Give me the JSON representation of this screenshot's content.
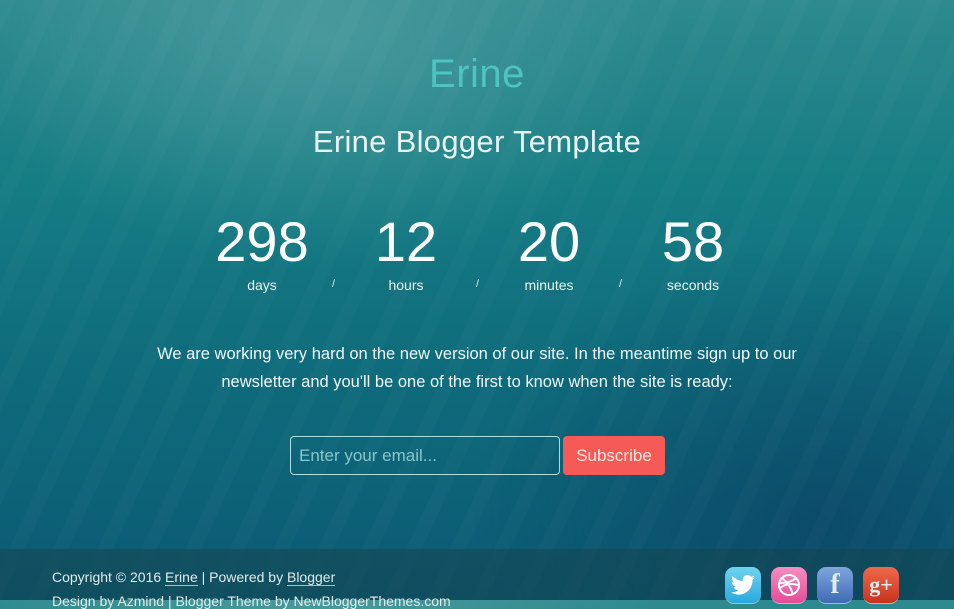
{
  "header": {
    "title": "Erine",
    "subtitle": "Erine Blogger Template"
  },
  "countdown": {
    "units": [
      {
        "value": "298",
        "label": "days"
      },
      {
        "value": "12",
        "label": "hours"
      },
      {
        "value": "20",
        "label": "minutes"
      },
      {
        "value": "58",
        "label": "seconds"
      }
    ],
    "separator": "/"
  },
  "message": "We are working very hard on the new version of our site. In the meantime sign up to our newsletter and you'll be one of the first to know when the site is ready:",
  "newsletter": {
    "email_placeholder": "Enter your email...",
    "email_value": "",
    "subscribe_label": "Subscribe"
  },
  "footer": {
    "copyright_prefix": "Copyright © 2016 ",
    "site_link": "Erine",
    "powered_text": " | Powered by ",
    "blogger_link": "Blogger",
    "design_line": "Design by Azmind | Blogger Theme by NewBloggerThemes.com",
    "social": [
      {
        "name": "twitter",
        "glyph": "🐦"
      },
      {
        "name": "dribbble",
        "glyph": "◎"
      },
      {
        "name": "facebook",
        "glyph": "f"
      },
      {
        "name": "google-plus",
        "glyph": "g+"
      }
    ]
  },
  "colors": {
    "accent_title": "#4dc4c0",
    "subscribe_button": "#f65a57"
  }
}
